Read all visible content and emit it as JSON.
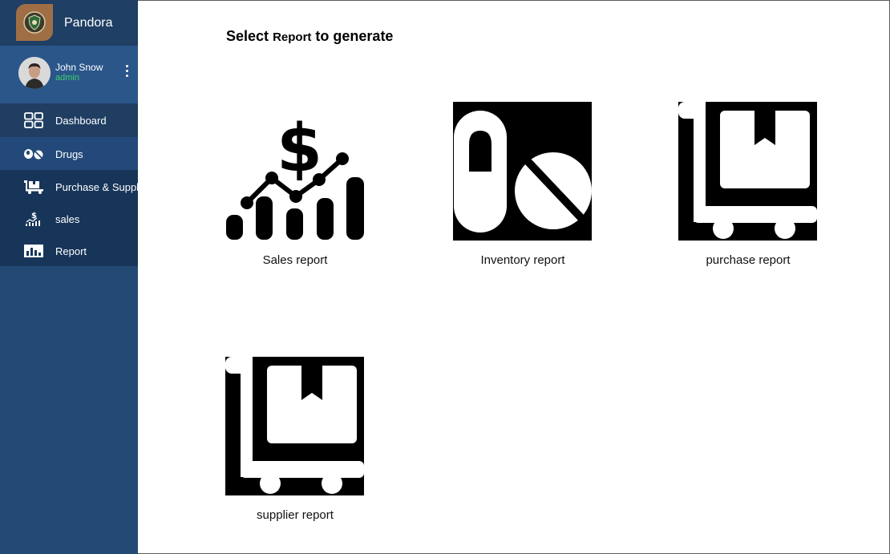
{
  "app": {
    "name": "Pandora"
  },
  "user": {
    "name": "John Snow",
    "role": "admin"
  },
  "nav": {
    "items": [
      {
        "label": "Dashboard",
        "icon": "dashboard-grid-icon"
      },
      {
        "label": "Drugs",
        "icon": "pills-icon"
      },
      {
        "label": "Purchase & Supply",
        "icon": "cart-icon"
      },
      {
        "label": "sales",
        "icon": "sales-chart-icon"
      },
      {
        "label": "Report",
        "icon": "report-chart-icon"
      }
    ]
  },
  "page": {
    "title_start": "Select",
    "title_mid": "Report",
    "title_end": "to generate"
  },
  "reports": [
    {
      "label": "Sales report",
      "icon": "sales-report-icon"
    },
    {
      "label": "Inventory report",
      "icon": "inventory-report-icon"
    },
    {
      "label": "purchase report",
      "icon": "purchase-report-icon"
    },
    {
      "label": "supplier report",
      "icon": "supplier-report-icon"
    }
  ],
  "colors": {
    "sidebar": "#234a74",
    "role": "#3fcf6e",
    "brand_logo": "#a06e45"
  }
}
